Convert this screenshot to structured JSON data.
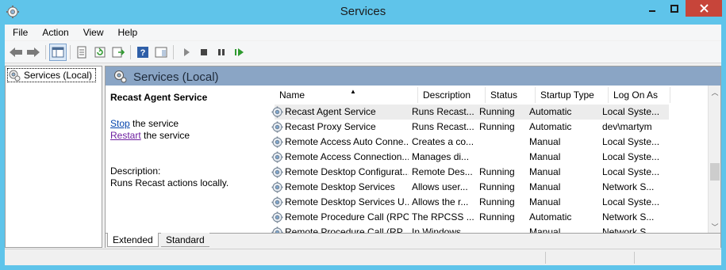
{
  "window": {
    "title": "Services"
  },
  "menu": [
    "File",
    "Action",
    "View",
    "Help"
  ],
  "tree": {
    "root_label": "Services (Local)"
  },
  "pane": {
    "title": "Services (Local)"
  },
  "detail": {
    "service_name": "Recast Agent Service",
    "stop_link": "Stop",
    "stop_suffix": " the service",
    "restart_link": "Restart",
    "restart_suffix": " the service",
    "description_label": "Description:",
    "description_text": "Runs Recast actions locally."
  },
  "columns": [
    "Name",
    "Description",
    "Status",
    "Startup Type",
    "Log On As"
  ],
  "rows": [
    [
      "Recast Agent Service",
      "Runs Recast...",
      "Running",
      "Automatic",
      "Local Syste..."
    ],
    [
      "Recast Proxy Service",
      "Runs Recast...",
      "Running",
      "Automatic",
      "dev\\martym"
    ],
    [
      "Remote Access Auto Conne...",
      "Creates a co...",
      "",
      "Manual",
      "Local Syste..."
    ],
    [
      "Remote Access Connection...",
      "Manages di...",
      "",
      "Manual",
      "Local Syste..."
    ],
    [
      "Remote Desktop Configurat...",
      "Remote Des...",
      "Running",
      "Manual",
      "Local Syste..."
    ],
    [
      "Remote Desktop Services",
      "Allows user...",
      "Running",
      "Manual",
      "Network S..."
    ],
    [
      "Remote Desktop Services U...",
      "Allows the r...",
      "Running",
      "Manual",
      "Local Syste..."
    ],
    [
      "Remote Procedure Call (RPC)",
      "The RPCSS ...",
      "Running",
      "Automatic",
      "Network S..."
    ],
    [
      "Remote Procedure Call (RP...",
      "In Windows...",
      "",
      "Manual",
      "Network S..."
    ]
  ],
  "selected_row": 0,
  "tabs": [
    "Extended",
    "Standard"
  ],
  "active_tab": "Extended",
  "colors": {
    "titlebar": "#5fc4ea",
    "close": "#c7453a",
    "pane_header": "#8aa5c5",
    "selected_row": "#ececec"
  }
}
